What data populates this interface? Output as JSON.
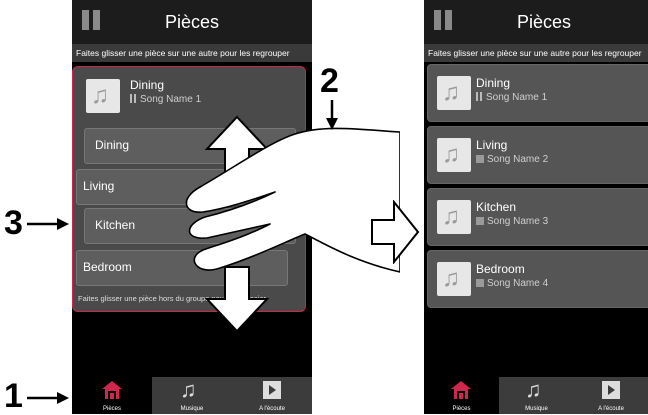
{
  "screen": {
    "title": "Pièces",
    "hint_top": "Faites glisser une pièce sur une autre pour les regrouper",
    "hint_bottom": "Faites glisser une pièce hors du groupe pour la dissocier"
  },
  "group": {
    "name": "Dining",
    "song": "Song Name 1",
    "members": [
      "Dining",
      "Living",
      "Kitchen",
      "Bedroom"
    ]
  },
  "rooms": [
    {
      "name": "Dining",
      "song": "Song Name 1",
      "state": "playing"
    },
    {
      "name": "Living",
      "song": "Song Name 2",
      "state": "stopped"
    },
    {
      "name": "Kitchen",
      "song": "Song Name 3",
      "state": "stopped"
    },
    {
      "name": "Bedroom",
      "song": "Song Name 4",
      "state": "stopped"
    }
  ],
  "tabs": [
    {
      "label": "Pièces",
      "icon": "house-icon",
      "active": true
    },
    {
      "label": "Musique",
      "icon": "music-note-icon",
      "active": false
    },
    {
      "label": "A l'écoute",
      "icon": "play-icon",
      "active": false
    }
  ],
  "callouts": {
    "one": "1",
    "two": "2",
    "three": "3"
  },
  "colors": {
    "accent": "#d0284d",
    "tab_bg": "#3c3c3c",
    "card": "#555555"
  }
}
